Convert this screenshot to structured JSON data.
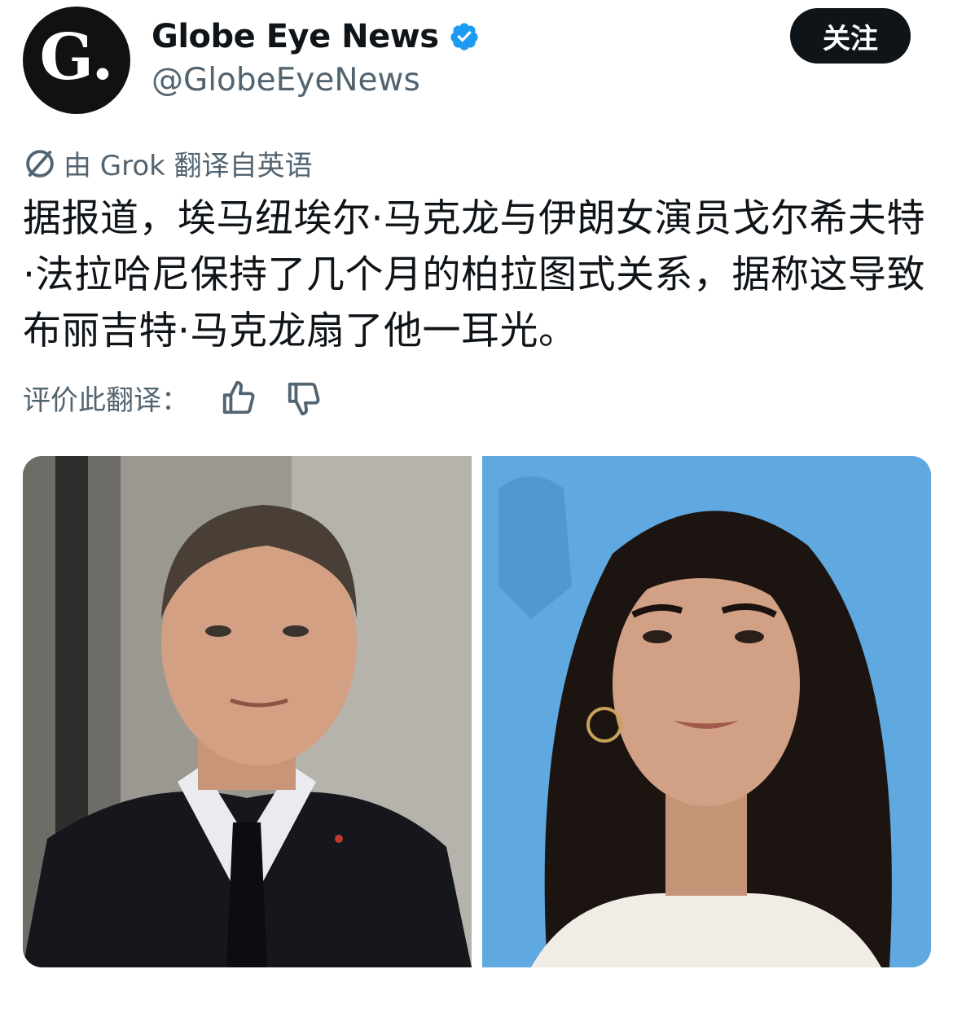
{
  "account": {
    "avatar_letter": "G.",
    "display_name": "Globe Eye News",
    "handle": "@GlobeEyeNews",
    "verified": true,
    "verified_color": "#1d9bf0"
  },
  "follow_button": {
    "label": "关注"
  },
  "translation": {
    "note": "由 Grok 翻译自英语",
    "rate_label": "评价此翻译：",
    "icons": [
      "translate-icon",
      "thumbs-up-icon",
      "thumbs-down-icon"
    ]
  },
  "post": {
    "text": "据报道，埃马纽埃尔·马克龙与伊朗女演员戈尔希夫特·法拉哈尼保持了几个月的柏拉图式关系，据称这导致布丽吉特·马克龙扇了他一耳光。"
  },
  "media": {
    "count": 2,
    "background_colors": [
      "#8e8c85",
      "#5ea7dd"
    ]
  }
}
